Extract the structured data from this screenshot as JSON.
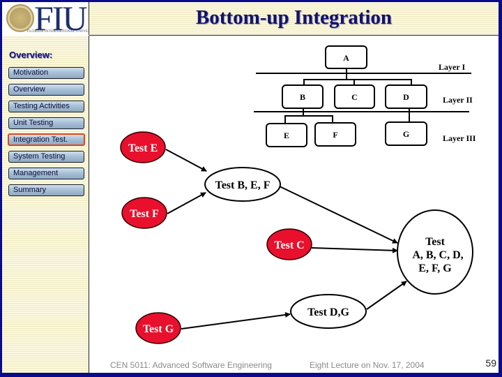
{
  "logo": {
    "text": "FIU",
    "subtext": "FLORIDA INTERNATIONAL UNIVERSITY",
    "icon": "university-seal-icon"
  },
  "title": "Bottom-up Integration",
  "sidebar": {
    "heading": "Overview:",
    "items": [
      {
        "label": "Motivation",
        "active": false
      },
      {
        "label": "Overview",
        "active": false
      },
      {
        "label": "Testing Activities",
        "active": false
      },
      {
        "label": "Unit Testing",
        "active": false
      },
      {
        "label": "Integration Test.",
        "active": true
      },
      {
        "label": "System Testing",
        "active": false
      },
      {
        "label": "Management",
        "active": false
      },
      {
        "label": "Summary",
        "active": false
      }
    ]
  },
  "hierarchy": {
    "modules": {
      "A": "A",
      "B": "B",
      "C": "C",
      "D": "D",
      "E": "E",
      "F": "F",
      "G": "G"
    },
    "layers": [
      "Layer I",
      "Layer II",
      "Layer III"
    ]
  },
  "flow": {
    "nodes": {
      "test_e": "Test E",
      "test_f": "Test F",
      "test_c": "Test C",
      "test_g": "Test G",
      "test_bef": "Test B, E, F",
      "test_dg": "Test D,G",
      "test_all_line1": "Test",
      "test_all_line2": "A, B, C, D,",
      "test_all_line3": "E, F, G"
    },
    "colors": {
      "unit_test_fill": "#e8102c",
      "integration_fill": "#ffffff"
    }
  },
  "footer": {
    "course": "CEN 5011: Advanced Software Engineering",
    "lecture": "Eight Lecture on Nov. 17, 2004",
    "page": "59"
  },
  "colors": {
    "frame": "#0a0a8c",
    "title": "#12126e",
    "active_border": "#e0461d"
  }
}
